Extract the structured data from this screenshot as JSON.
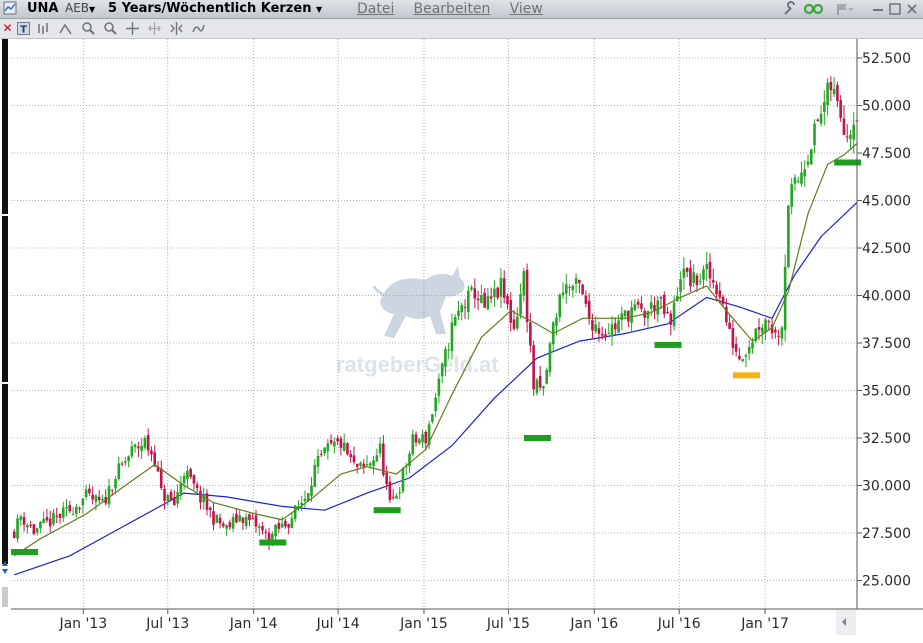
{
  "window": {
    "symbol": "UNA",
    "exchange": "AEB",
    "period_label": "5 Years/Wöchentlich Kerzen",
    "menu": [
      "Datei",
      "Bearbeiten",
      "View"
    ]
  },
  "watermark": {
    "text": "ratgeberGeld.at"
  },
  "colors": {
    "up": "#23a623",
    "down": "#c4124a",
    "sma_short": "#5e7f1a",
    "sma_long": "#1a22d6",
    "support_marker": "#1e9e1e",
    "support_marker_alt": "#f3b312",
    "grid": "#9a9a9a"
  },
  "chart_data": {
    "type": "candlestick",
    "y_axis": {
      "min": 23.5,
      "max": 53.5,
      "ticks": [
        "25.000",
        "27.500",
        "30.000",
        "32.500",
        "35.000",
        "37.500",
        "40.000",
        "42.500",
        "45.000",
        "47.500",
        "50.000",
        "52.500"
      ],
      "tick_values": [
        25,
        27.5,
        30,
        32.5,
        35,
        37.5,
        40,
        42.5,
        45,
        47.5,
        50,
        52.5
      ]
    },
    "x_axis": {
      "start": "2012-07-30",
      "end": "2017-07-17",
      "ticks": [
        "Jan '13",
        "Jul '13",
        "Jan '14",
        "Jul '14",
        "Jan '15",
        "Jul '15",
        "Jan '16",
        "Jul '16",
        "Jan '17"
      ],
      "tick_dates": [
        "2013-01-01",
        "2013-07-01",
        "2014-01-01",
        "2014-07-01",
        "2015-01-01",
        "2015-07-01",
        "2016-01-01",
        "2016-07-01",
        "2017-01-01"
      ]
    },
    "grid": true,
    "close_path": [
      [
        "2012-08-06",
        27.6
      ],
      [
        "2012-08-20",
        28.4
      ],
      [
        "2012-09-17",
        27.6
      ],
      [
        "2012-10-22",
        28.1
      ],
      [
        "2012-12-03",
        28.7
      ],
      [
        "2013-01-07",
        29.4
      ],
      [
        "2013-02-11",
        29.0
      ],
      [
        "2013-03-11",
        30.5
      ],
      [
        "2013-04-15",
        31.8
      ],
      [
        "2013-05-13",
        32.3
      ],
      [
        "2013-06-03",
        31.4
      ],
      [
        "2013-06-17",
        29.6
      ],
      [
        "2013-07-15",
        29.0
      ],
      [
        "2013-08-05",
        30.8
      ],
      [
        "2013-09-02",
        29.6
      ],
      [
        "2013-10-07",
        28.3
      ],
      [
        "2013-11-04",
        27.7
      ],
      [
        "2013-12-02",
        28.4
      ],
      [
        "2014-01-06",
        27.9
      ],
      [
        "2014-02-03",
        27.2
      ],
      [
        "2014-02-17",
        27.6
      ],
      [
        "2014-03-17",
        28.1
      ],
      [
        "2014-04-21",
        29.4
      ],
      [
        "2014-05-12",
        30.9
      ],
      [
        "2014-06-09",
        31.9
      ],
      [
        "2014-07-07",
        32.2
      ],
      [
        "2014-08-04",
        31.0
      ],
      [
        "2014-08-25",
        30.8
      ],
      [
        "2014-09-29",
        31.9
      ],
      [
        "2014-10-20",
        28.9
      ],
      [
        "2014-11-10",
        30.0
      ],
      [
        "2014-12-08",
        32.3
      ],
      [
        "2015-01-05",
        32.5
      ],
      [
        "2015-02-02",
        35.3
      ],
      [
        "2015-03-02",
        38.3
      ],
      [
        "2015-03-23",
        39.4
      ],
      [
        "2015-04-20",
        40.2
      ],
      [
        "2015-05-11",
        39.3
      ],
      [
        "2015-06-15",
        40.4
      ],
      [
        "2015-07-13",
        38.3
      ],
      [
        "2015-08-03",
        41.0
      ],
      [
        "2015-08-24",
        35.2
      ],
      [
        "2015-09-14",
        35.0
      ],
      [
        "2015-10-05",
        38.4
      ],
      [
        "2015-10-26",
        40.5
      ],
      [
        "2015-11-30",
        40.4
      ],
      [
        "2015-12-21",
        38.8
      ],
      [
        "2016-01-18",
        38.1
      ],
      [
        "2016-02-15",
        38.4
      ],
      [
        "2016-03-21",
        39.3
      ],
      [
        "2016-04-18",
        39.0
      ],
      [
        "2016-05-16",
        39.7
      ],
      [
        "2016-06-13",
        38.4
      ],
      [
        "2016-07-04",
        41.2
      ],
      [
        "2016-08-01",
        40.7
      ],
      [
        "2016-08-29",
        41.2
      ],
      [
        "2016-09-26",
        40.2
      ],
      [
        "2016-10-17",
        37.9
      ],
      [
        "2016-11-07",
        36.8
      ],
      [
        "2016-11-28",
        37.5
      ],
      [
        "2016-12-19",
        38.5
      ],
      [
        "2017-01-09",
        38.8
      ],
      [
        "2017-01-23",
        37.9
      ],
      [
        "2017-02-06",
        38.6
      ],
      [
        "2017-02-20",
        45.0
      ],
      [
        "2017-03-13",
        46.1
      ],
      [
        "2017-04-03",
        47.6
      ],
      [
        "2017-05-01",
        49.6
      ],
      [
        "2017-05-22",
        51.0
      ],
      [
        "2017-06-12",
        49.6
      ],
      [
        "2017-06-26",
        48.6
      ],
      [
        "2017-07-17",
        49.8
      ]
    ],
    "sma_short": [
      [
        "2012-08-06",
        26.3
      ],
      [
        "2012-10-01",
        27.2
      ],
      [
        "2013-01-07",
        28.5
      ],
      [
        "2013-04-01",
        30.0
      ],
      [
        "2013-06-03",
        31.1
      ],
      [
        "2013-08-05",
        30.0
      ],
      [
        "2013-10-07",
        29.1
      ],
      [
        "2014-01-06",
        28.5
      ],
      [
        "2014-03-03",
        28.2
      ],
      [
        "2014-05-05",
        29.3
      ],
      [
        "2014-07-07",
        30.6
      ],
      [
        "2014-09-01",
        31.0
      ],
      [
        "2014-11-03",
        30.6
      ],
      [
        "2015-01-05",
        31.9
      ],
      [
        "2015-03-02",
        34.8
      ],
      [
        "2015-05-04",
        37.8
      ],
      [
        "2015-07-06",
        39.2
      ],
      [
        "2015-08-31",
        38.5
      ],
      [
        "2015-10-05",
        38.0
      ],
      [
        "2015-12-07",
        38.8
      ],
      [
        "2016-03-07",
        38.8
      ],
      [
        "2016-05-02",
        39.1
      ],
      [
        "2016-07-04",
        39.9
      ],
      [
        "2016-08-29",
        40.5
      ],
      [
        "2016-10-10",
        39.2
      ],
      [
        "2016-12-05",
        37.6
      ],
      [
        "2017-01-16",
        38.3
      ],
      [
        "2017-02-20",
        40.2
      ],
      [
        "2017-04-03",
        44.3
      ],
      [
        "2017-05-15",
        46.9
      ],
      [
        "2017-06-19",
        47.4
      ],
      [
        "2017-07-17",
        48.0
      ]
    ],
    "sma_long": [
      [
        "2012-08-06",
        25.3
      ],
      [
        "2012-12-03",
        26.3
      ],
      [
        "2013-04-01",
        27.9
      ],
      [
        "2013-08-05",
        29.6
      ],
      [
        "2013-11-04",
        29.4
      ],
      [
        "2014-03-03",
        28.9
      ],
      [
        "2014-06-02",
        28.7
      ],
      [
        "2014-09-01",
        29.6
      ],
      [
        "2014-12-01",
        30.4
      ],
      [
        "2015-03-02",
        32.1
      ],
      [
        "2015-06-01",
        34.6
      ],
      [
        "2015-08-31",
        36.7
      ],
      [
        "2015-11-30",
        37.6
      ],
      [
        "2016-03-07",
        38.0
      ],
      [
        "2016-06-06",
        38.5
      ],
      [
        "2016-08-29",
        39.9
      ],
      [
        "2016-11-07",
        39.4
      ],
      [
        "2017-01-16",
        38.8
      ],
      [
        "2017-03-06",
        41.1
      ],
      [
        "2017-05-01",
        43.1
      ],
      [
        "2017-07-17",
        44.9
      ]
    ],
    "support_markers": [
      {
        "date": "2012-08-27",
        "value": 26.5,
        "color": "green"
      },
      {
        "date": "2014-02-10",
        "value": 27.0,
        "color": "green"
      },
      {
        "date": "2014-10-13",
        "value": 28.7,
        "color": "green"
      },
      {
        "date": "2015-08-31",
        "value": 32.5,
        "color": "green"
      },
      {
        "date": "2016-06-06",
        "value": 37.4,
        "color": "green"
      },
      {
        "date": "2016-11-21",
        "value": 35.8,
        "color": "orange"
      },
      {
        "date": "2017-06-26",
        "value": 47.0,
        "color": "green"
      }
    ]
  }
}
